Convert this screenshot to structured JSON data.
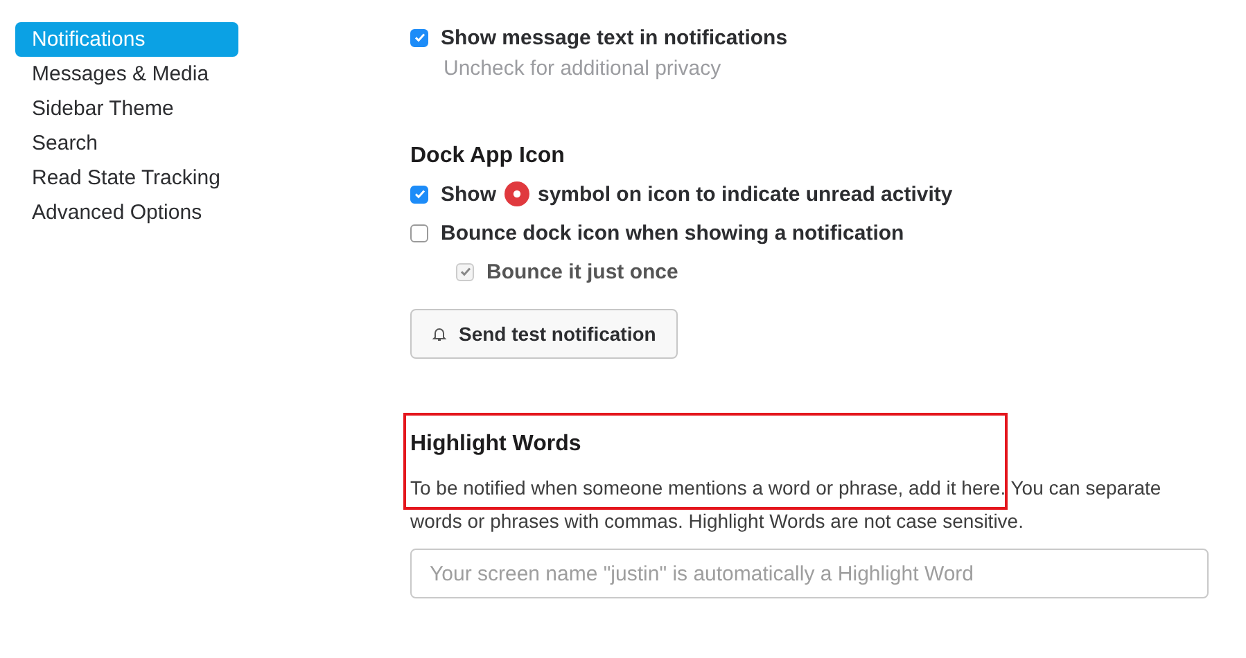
{
  "sidebar": {
    "items": [
      {
        "label": "Notifications",
        "selected": true
      },
      {
        "label": "Messages & Media",
        "selected": false
      },
      {
        "label": "Sidebar Theme",
        "selected": false
      },
      {
        "label": "Search",
        "selected": false
      },
      {
        "label": "Read State Tracking",
        "selected": false
      },
      {
        "label": "Advanced Options",
        "selected": false
      }
    ]
  },
  "message_text": {
    "label": "Show message text in notifications",
    "checked": true,
    "hint": "Uncheck for additional privacy"
  },
  "dock_app_icon": {
    "heading": "Dock App Icon",
    "options": [
      {
        "kind": "badge",
        "label_before": "Show",
        "label_after": "symbol on icon to indicate unread activity",
        "checked": true,
        "disabled": false
      },
      {
        "kind": "plain",
        "label": "Bounce dock icon when showing a notification",
        "checked": false,
        "disabled": false,
        "children": [
          {
            "kind": "plain",
            "label": "Bounce it just once",
            "checked": true,
            "disabled": true
          }
        ]
      }
    ],
    "test_button": "Send test notification"
  },
  "highlight_words": {
    "heading": "Highlight Words",
    "annotated": true,
    "description": "To be notified when someone mentions a word or phrase, add it here. You can separate words or phrases with commas. Highlight Words are not case sensitive.",
    "placeholder": "Your screen name \"justin\" is automatically a Highlight Word"
  }
}
